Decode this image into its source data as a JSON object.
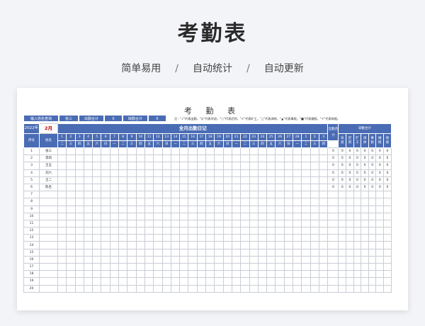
{
  "page": {
    "title": "考勤表",
    "features": [
      "简单易用",
      "自动统计",
      "自动更新"
    ],
    "separator": "/"
  },
  "sheet": {
    "title": "考  勤  表",
    "toolbar": {
      "search_label": "输入姓名查询",
      "search_value": "张三",
      "attendance_total_label": "出勤合计",
      "attendance_total_value": "0",
      "absence_total_label": "缺勤合计",
      "absence_total_value": "0"
    },
    "note": "注：\"√\"代表出勤，\"◎\"代表早退，\"○\"代表迟到，\"×\"代表旷工，\"△\"代表调休，\"▲\"代表事假，\"■\"代表婚假，\"+\"代表病假。",
    "year": "2022年",
    "month": "2月",
    "header": {
      "serial": "序号",
      "name": "姓名",
      "daily_log": "全月出勤日记",
      "attendance_total": "出勤合计",
      "absence_total": "缺勤合计",
      "absence_types": [
        "早退",
        "迟到",
        "旷工",
        "调休",
        "事假",
        "婚假",
        "病假"
      ]
    },
    "dates": [
      "1",
      "2",
      "3",
      "4",
      "5",
      "6",
      "7",
      "8",
      "9",
      "10",
      "11",
      "12",
      "13",
      "14",
      "15",
      "16",
      "17",
      "18",
      "19",
      "20",
      "21",
      "22",
      "23",
      "24",
      "25",
      "26",
      "27",
      "28",
      "1",
      "2",
      "3"
    ],
    "weekdays": [
      "二",
      "三",
      "四",
      "五",
      "六",
      "日",
      "一",
      "二",
      "三",
      "四",
      "五",
      "六",
      "日",
      "一",
      "二",
      "三",
      "四",
      "五",
      "六",
      "日",
      "一",
      "二",
      "三",
      "四",
      "五",
      "六",
      "日",
      "一",
      "二",
      "三",
      "四"
    ],
    "rows": [
      {
        "no": "1",
        "name": "张三",
        "total": "0",
        "counts": [
          "0",
          "0",
          "0",
          "0",
          "0",
          "0",
          "0"
        ]
      },
      {
        "no": "2",
        "name": "李四",
        "total": "0",
        "counts": [
          "0",
          "0",
          "0",
          "0",
          "0",
          "0",
          "0"
        ]
      },
      {
        "no": "3",
        "name": "王五",
        "total": "0",
        "counts": [
          "0",
          "0",
          "0",
          "0",
          "0",
          "0",
          "0"
        ]
      },
      {
        "no": "4",
        "name": "刘六",
        "total": "0",
        "counts": [
          "0",
          "0",
          "0",
          "0",
          "0",
          "0",
          "0"
        ]
      },
      {
        "no": "5",
        "name": "王二",
        "total": "0",
        "counts": [
          "0",
          "0",
          "0",
          "0",
          "0",
          "0",
          "0"
        ]
      },
      {
        "no": "6",
        "name": "陈名",
        "total": "0",
        "counts": [
          "0",
          "0",
          "0",
          "0",
          "0",
          "0",
          "0"
        ]
      },
      {
        "no": "7",
        "name": "",
        "total": "",
        "counts": []
      },
      {
        "no": "8",
        "name": "",
        "total": "",
        "counts": []
      },
      {
        "no": "9",
        "name": "",
        "total": "",
        "counts": []
      },
      {
        "no": "10",
        "name": "",
        "total": "",
        "counts": []
      },
      {
        "no": "11",
        "name": "",
        "total": "",
        "counts": []
      },
      {
        "no": "12",
        "name": "",
        "total": "",
        "counts": []
      },
      {
        "no": "13",
        "name": "",
        "total": "",
        "counts": []
      },
      {
        "no": "14",
        "name": "",
        "total": "",
        "counts": []
      },
      {
        "no": "15",
        "name": "",
        "total": "",
        "counts": []
      },
      {
        "no": "16",
        "name": "",
        "total": "",
        "counts": []
      },
      {
        "no": "17",
        "name": "",
        "total": "",
        "counts": []
      },
      {
        "no": "18",
        "name": "",
        "total": "",
        "counts": []
      },
      {
        "no": "19",
        "name": "",
        "total": "",
        "counts": []
      },
      {
        "no": "20",
        "name": "",
        "total": "",
        "counts": []
      }
    ]
  }
}
